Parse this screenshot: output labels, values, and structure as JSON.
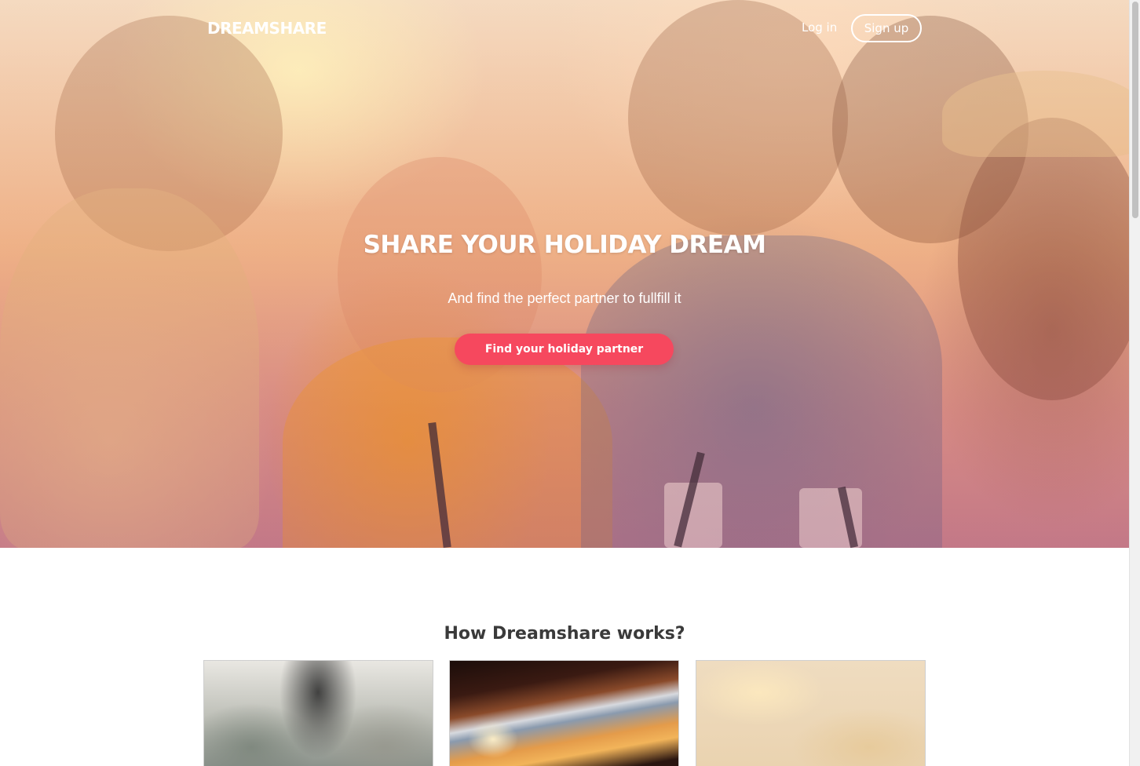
{
  "nav": {
    "brand": "DREAMSHARE",
    "login_label": "Log in",
    "signup_label": "Sign up"
  },
  "hero": {
    "title": "SHARE YOUR HOLIDAY DREAM",
    "subtitle": "And find the perfect partner to fullfill it",
    "cta_label": "Find your holiday partner",
    "image": "group-of-friends-laughing-photo"
  },
  "how_it_works": {
    "title": "How Dreamshare works?",
    "cards": [
      {
        "image": "person-sitting-photo"
      },
      {
        "image": "sunset-through-window-photo"
      },
      {
        "image": "sandy-texture-photo"
      }
    ]
  },
  "colors": {
    "accent": "#f6485e",
    "heading_text": "#3a3a3a",
    "nav_text": "#ffffff"
  }
}
